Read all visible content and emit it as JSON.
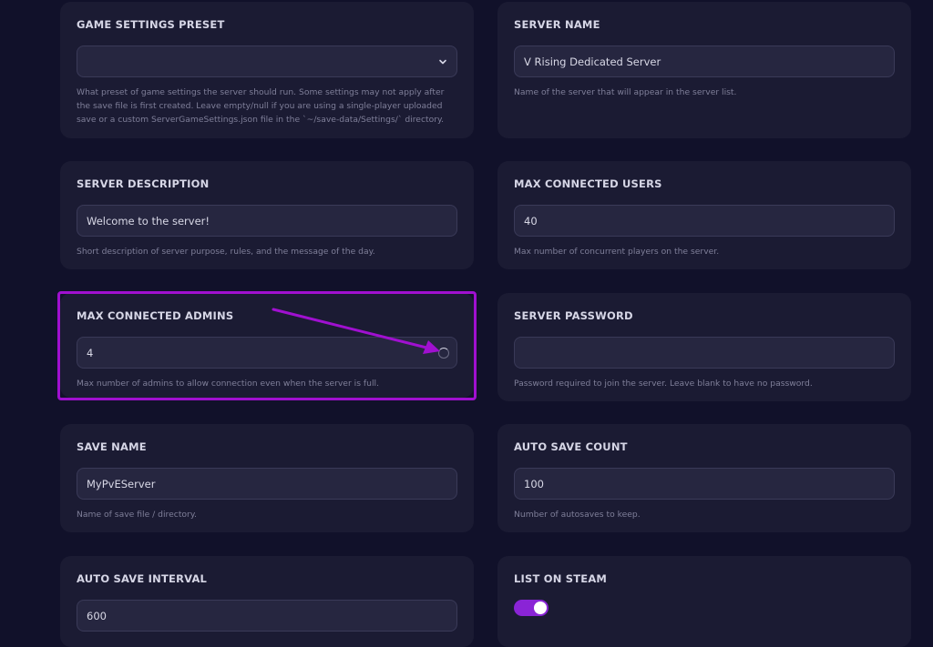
{
  "cards": {
    "game_settings_preset": {
      "title": "GAME SETTINGS PRESET",
      "value": "",
      "help": "What preset of game settings the server should run. Some settings may not apply after the save file is first created. Leave empty/null if you are using a single-player uploaded save or a custom ServerGameSettings.json file in the `~/save-data/Settings/` directory."
    },
    "server_name": {
      "title": "SERVER NAME",
      "value": "V Rising Dedicated Server",
      "help": "Name of the server that will appear in the server list."
    },
    "server_description": {
      "title": "SERVER DESCRIPTION",
      "value": "Welcome to the server!",
      "help": "Short description of server purpose, rules, and the message of the day."
    },
    "max_connected_users": {
      "title": "MAX CONNECTED USERS",
      "value": "40",
      "help": "Max number of concurrent players on the server."
    },
    "max_connected_admins": {
      "title": "MAX CONNECTED ADMINS",
      "value": "4",
      "help": "Max number of admins to allow connection even when the server is full."
    },
    "server_password": {
      "title": "SERVER PASSWORD",
      "value": "",
      "help": "Password required to join the server. Leave blank to have no password."
    },
    "save_name": {
      "title": "SAVE NAME",
      "value": "MyPvEServer",
      "help": "Name of save file / directory."
    },
    "auto_save_count": {
      "title": "AUTO SAVE COUNT",
      "value": "100",
      "help": "Number of autosaves to keep."
    },
    "auto_save_interval": {
      "title": "AUTO SAVE INTERVAL",
      "value": "600"
    },
    "list_on_steam": {
      "title": "LIST ON STEAM",
      "enabled": true
    }
  },
  "icons": {
    "preset_dropdown": "chevron-down-icon",
    "admins_loading": "spinner-icon"
  },
  "colors": {
    "background": "#11112a",
    "card": "#1b1b33",
    "field": "#262640",
    "toggle_on": "#8a24d6",
    "highlight": "#a010d0"
  }
}
